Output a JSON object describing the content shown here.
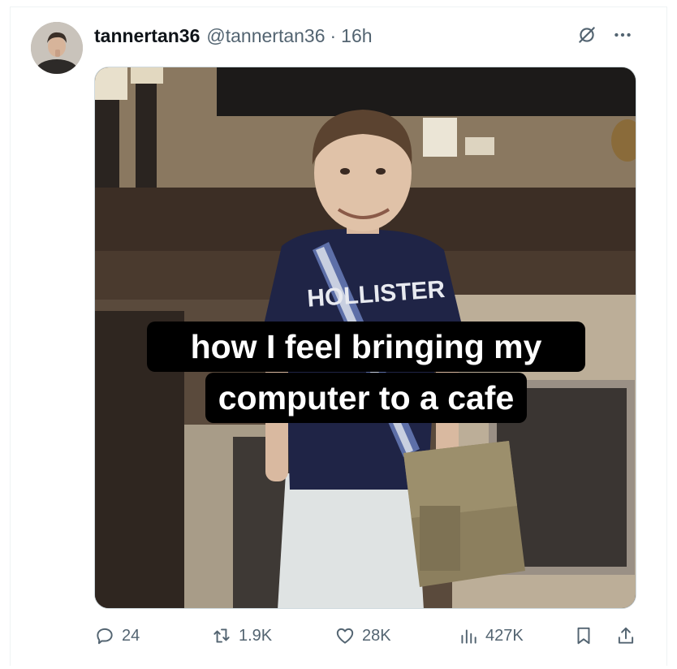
{
  "post": {
    "display_name": "tannertan36",
    "handle": "@tannertan36",
    "separator": "·",
    "time": "16h",
    "media": {
      "caption_line1": "how I feel bringing my",
      "caption_line2": "computer to a cafe",
      "shirt_text": "HOLLISTER"
    },
    "stats": {
      "replies": "24",
      "reposts": "1.9K",
      "likes": "28K",
      "views": "427K"
    }
  },
  "icons": {
    "top_right": [
      "grok-icon",
      "more-icon"
    ],
    "actions": [
      "reply-icon",
      "repost-icon",
      "like-icon",
      "views-icon",
      "bookmark-icon",
      "share-icon"
    ]
  },
  "colors": {
    "text_primary": "#0f1419",
    "text_secondary": "#536471",
    "border": "#eff3f4"
  }
}
